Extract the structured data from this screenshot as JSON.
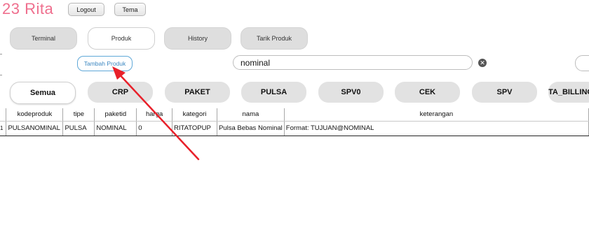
{
  "app": {
    "title": "23 Rita"
  },
  "top_buttons": {
    "logout": "Logout",
    "theme": "Tema"
  },
  "nav_tabs": [
    "Terminal",
    "Produk",
    "History",
    "Tarik Produk"
  ],
  "active_nav": "Produk",
  "toolbar": {
    "add_product": "Tambah Produk",
    "search_value": "nominal"
  },
  "category_tabs": [
    "Semua",
    "CRP",
    "PAKET",
    "PULSA",
    "SPV0",
    "CEK",
    "SPV",
    "TA_BILLING_"
  ],
  "active_category": "Semua",
  "table": {
    "columns": [
      "kodeproduk",
      "tipe",
      "paketid",
      "harga",
      "kategori",
      "nama",
      "keterangan"
    ],
    "rows": [
      {
        "index": "1",
        "cells": [
          "PULSANOMINAL",
          "PULSA",
          "NOMINAL",
          "0",
          "RITATOPUP",
          "Pulsa Bebas Nominal",
          "Format: TUJUAN@NOMINAL"
        ]
      }
    ]
  },
  "colors": {
    "title": "#ef6f8e",
    "accent": "#3a86c0",
    "arrow": "#e8202a"
  },
  "icons": {
    "clear": "clear-icon",
    "annotation": "arrow-icon"
  }
}
